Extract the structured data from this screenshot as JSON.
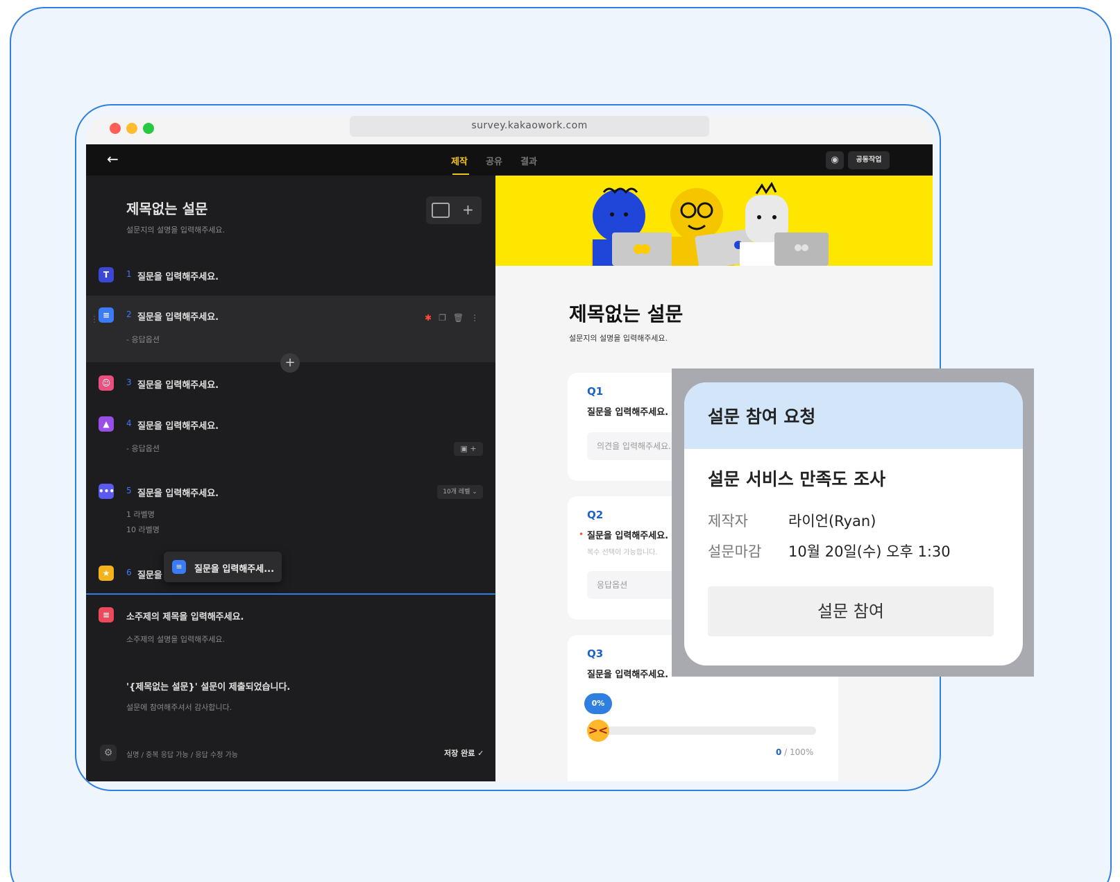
{
  "browser": {
    "url": "survey.kakaowork.com"
  },
  "header": {
    "tabs": [
      {
        "label": "제작",
        "active": true
      },
      {
        "label": "공유",
        "active": false
      },
      {
        "label": "결과",
        "active": false
      }
    ],
    "collab_label": "공동작업"
  },
  "editor": {
    "title": "제목없는 설문",
    "description": "설문지의 설명을 입력해주세요.",
    "questions": [
      {
        "num": "1",
        "text": "질문을 입력해주세요.",
        "icon": "T",
        "color": "#3b48d6"
      },
      {
        "num": "2",
        "text": "질문을 입력해주세요.",
        "icon": "≡",
        "color": "#3b7cf6",
        "sub": "- 응답옵션"
      },
      {
        "num": "3",
        "text": "질문을 입력해주세요.",
        "icon": "☺",
        "color": "#ea4f7f"
      },
      {
        "num": "4",
        "text": "질문을 입력해주세요.",
        "icon": "▲",
        "color": "#9a4ee8",
        "sub": "- 응답옵션"
      },
      {
        "num": "5",
        "text": "질문을 입력해주세요.",
        "icon": "•••",
        "color": "#5a59f0",
        "sub1": "1  라벨명",
        "sub2": "10 라벨명",
        "scale": "10개 레벨 ⌄"
      },
      {
        "num": "6",
        "text": "질문을",
        "icon": "★",
        "color": "#f5b31b"
      }
    ],
    "drag_ghost": "질문을 입력해주세...",
    "section_title": "소주제의 제목을 입력해주세요.",
    "section_desc": "소주제의 설명을 입력해주세요.",
    "ending_title": "'{제목없는 설문}' 설문이 제출되었습니다.",
    "ending_desc": "설문에 참여해주셔서 감사합니다.",
    "footer_options": "실명 / 중복 응답 가능 / 응답 수정 가능",
    "save_status": "저장 완료 ✓"
  },
  "preview": {
    "title": "제목없는 설문",
    "description": "설문지의 설명을 입력해주세요.",
    "q1": {
      "label": "Q1",
      "text": "질문을 입력해주세요.",
      "placeholder": "의견을 입력해주세요."
    },
    "q2": {
      "label": "Q2",
      "text": "질문을 입력해주세요.",
      "hint": "복수 선택이 가능합니다.",
      "option": "응답옵션"
    },
    "q3": {
      "label": "Q3",
      "text": "질문을 입력해주세요.",
      "percent": "0%",
      "value_current": "0",
      "value_max": " / 100%"
    }
  },
  "popup": {
    "header": "설문 참여 요청",
    "survey_title": "설문 서비스 만족도 조사",
    "author_label": "제작자",
    "author_value": "라이언(Ryan)",
    "deadline_label": "설문마감",
    "deadline_value": "10월 20일(수) 오후 1:30",
    "button": "설문 참여"
  }
}
